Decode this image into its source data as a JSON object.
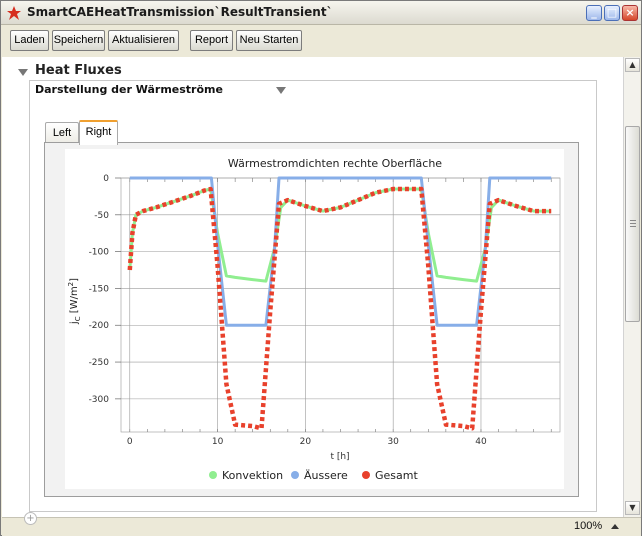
{
  "window": {
    "title": "SmartCAEHeatTransmission`ResultTransient`",
    "controls": [
      "minimize",
      "maximize",
      "close"
    ]
  },
  "toolbar": {
    "buttons": [
      "Laden",
      "Speichern",
      "Aktualisieren",
      "Report",
      "Neu Starten"
    ]
  },
  "section": {
    "title": "Heat Fluxes",
    "dropdown_label": "Darstellung der Wärmeströme"
  },
  "tabs": {
    "items": [
      "Left",
      "Right"
    ],
    "selected": "Right"
  },
  "status": {
    "zoom": "100%"
  },
  "colors": {
    "konvektion": "#90ee90",
    "aeussere": "#87aee8",
    "gesamt": "#e8412c",
    "tab_accent": "#f0a030"
  },
  "chart_data": {
    "type": "line",
    "title": "Wärmestromdichten rechte Oberfläche",
    "xlabel": "t [h]",
    "ylabel": "j_C [W/m^2]",
    "xlim": [
      -1,
      49
    ],
    "ylim": [
      -345,
      0
    ],
    "xticks": [
      0,
      10,
      20,
      30,
      40
    ],
    "yticks": [
      0,
      -50,
      -100,
      -150,
      -200,
      -250,
      -300
    ],
    "grid": true,
    "legend_position": "bottom",
    "series": [
      {
        "name": "Konvektion",
        "style": "solid",
        "x": [
          0,
          0.3,
          0.7,
          1.5,
          3,
          5,
          7,
          8.5,
          9.2,
          10,
          11,
          12,
          14,
          15.5,
          16.5,
          17.2,
          18,
          20,
          22,
          24,
          26,
          28,
          30,
          32,
          33.2,
          34,
          35,
          36,
          38,
          39.5,
          40.5,
          41.2,
          42,
          44,
          46,
          48
        ],
        "y": [
          -125,
          -75,
          -50,
          -45,
          -40,
          -32,
          -24,
          -17,
          -15,
          -75,
          -133,
          -135,
          -138,
          -140,
          -95,
          -40,
          -30,
          -38,
          -45,
          -40,
          -30,
          -20,
          -15,
          -15,
          -15,
          -75,
          -133,
          -135,
          -138,
          -140,
          -95,
          -40,
          -30,
          -38,
          -45,
          -45
        ]
      },
      {
        "name": "Äussere",
        "style": "solid",
        "x": [
          0,
          9.3,
          10,
          11,
          15.5,
          16.5,
          17,
          33.2,
          34,
          35,
          39.5,
          40.5,
          41,
          48
        ],
        "y": [
          0,
          0,
          -90,
          -200,
          -200,
          -95,
          0,
          0,
          -90,
          -200,
          -200,
          -95,
          0,
          0
        ]
      },
      {
        "name": "Gesamt",
        "style": "dotted",
        "x": [
          0,
          0.3,
          0.7,
          1.5,
          3,
          5,
          7,
          8.5,
          9.2,
          10,
          11,
          12,
          14,
          15,
          16,
          17,
          18,
          20,
          22,
          24,
          26,
          28,
          30,
          32,
          33.2,
          34,
          35,
          36,
          38,
          39,
          40,
          41,
          42,
          44,
          46,
          48
        ],
        "y": [
          -125,
          -75,
          -50,
          -45,
          -40,
          -32,
          -24,
          -17,
          -15,
          -120,
          -280,
          -335,
          -337,
          -340,
          -180,
          -35,
          -30,
          -38,
          -45,
          -40,
          -30,
          -20,
          -15,
          -15,
          -15,
          -120,
          -280,
          -335,
          -337,
          -340,
          -180,
          -35,
          -30,
          -38,
          -45,
          -45
        ]
      }
    ]
  }
}
